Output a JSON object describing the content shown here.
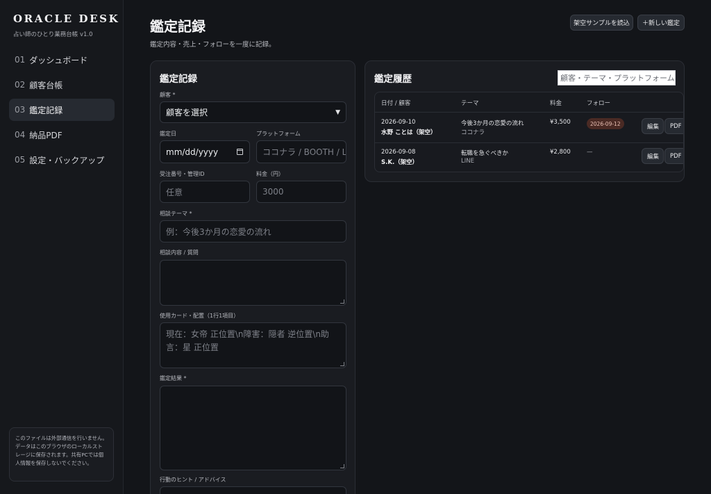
{
  "sidebar": {
    "brand": "ORACLE DESK",
    "subtitle": "占い師のひとり業務台帳 v1.0",
    "items": [
      {
        "num": "01",
        "label": "ダッシュボード"
      },
      {
        "num": "02",
        "label": "顧客台帳"
      },
      {
        "num": "03",
        "label": "鑑定記録"
      },
      {
        "num": "04",
        "label": "納品PDF"
      },
      {
        "num": "05",
        "label": "設定・バックアップ"
      }
    ],
    "active_index": 2,
    "note": "このファイルは外部通信を行いません。データはこのブラウザのローカルストレージに保存されます。共有PCでは個人情報を保存しないでください。"
  },
  "header": {
    "title": "鑑定記録",
    "subtitle": "鑑定内容・売上・フォローを一度に記録。",
    "sample_button": "架空サンプルを読込",
    "new_button": "＋新しい鑑定"
  },
  "form": {
    "title": "鑑定記録",
    "customer_label": "顧客 *",
    "customer_value": "顧客を選択",
    "date_label": "鑑定日",
    "date_placeholder": "mm/dd/yyyy",
    "platform_label": "プラットフォーム",
    "platform_placeholder": "ココナラ / BOOTH / LI",
    "order_label": "受注番号・管理ID",
    "order_placeholder": "任意",
    "fee_label": "料金（円）",
    "fee_placeholder": "3000",
    "theme_label": "相談テーマ *",
    "theme_placeholder": "例：今後3か月の恋愛の流れ",
    "question_label": "相談内容 / 質問",
    "question_placeholder": "",
    "cards_label": "使用カード・配置（1行1項目）",
    "cards_placeholder": "現在：女帝 正位置\\n障害：隠者 逆位置\\n助言：星 正位置",
    "result_label": "鑑定結果 *",
    "result_placeholder": "",
    "advice_label": "行動のヒント / アドバイス"
  },
  "history": {
    "title": "鑑定履歴",
    "search_placeholder": "顧客・テーマ・プラットフォーム",
    "columns": [
      "日付 / 顧客",
      "テーマ",
      "料金",
      "フォロー"
    ],
    "rows": [
      {
        "date": "2026-09-10",
        "customer": "水野 ことは（架空）",
        "theme": "今後3か月の恋愛の流れ",
        "platform": "ココナラ",
        "fee": "¥3,500",
        "follow": "2026-09-12",
        "edit": "編集",
        "pdf": "PDF"
      },
      {
        "date": "2026-09-08",
        "customer": "S.K.（架空）",
        "theme": "転職を急ぐべきか",
        "platform": "LINE",
        "fee": "¥2,800",
        "follow": "—",
        "edit": "編集",
        "pdf": "PDF"
      }
    ]
  },
  "colors": {
    "background": "#131519",
    "panel": "#1a1c21",
    "accent_badge": "#4a2a24"
  }
}
